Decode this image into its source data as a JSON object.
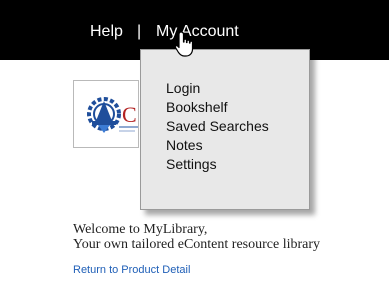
{
  "nav": {
    "help_label": "Help",
    "separator": "|",
    "account_label": "My Account"
  },
  "menu": {
    "items": [
      "Login",
      "Bookshelf",
      "Saved Searches",
      "Notes",
      "Settings"
    ]
  },
  "logo": {
    "partial_text": "C"
  },
  "welcome": {
    "line1": "Welcome to MyLibrary,",
    "line2": "Your own tailored eContent resource library"
  },
  "footer": {
    "return_link": "Return to Product Detail"
  },
  "colors": {
    "topbar": "#000000",
    "menu_bg": "#e8e8e8",
    "link": "#1f5fb7",
    "logo_blue": "#1f4e9b",
    "logo_red": "#b22222"
  },
  "icons": {
    "cursor": "hand-pointer-icon",
    "logo": "institution-logo"
  }
}
